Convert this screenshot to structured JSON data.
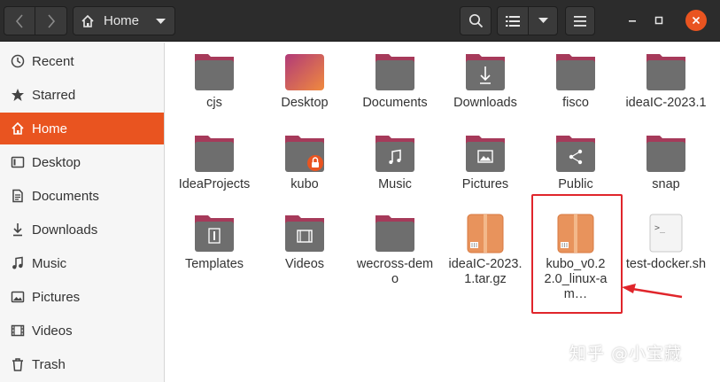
{
  "header": {
    "location": "Home",
    "window_controls": [
      "minimize",
      "maximize",
      "close"
    ]
  },
  "sidebar": {
    "items": [
      {
        "label": "Recent",
        "icon": "clock-icon"
      },
      {
        "label": "Starred",
        "icon": "star-icon"
      },
      {
        "label": "Home",
        "icon": "home-icon",
        "active": true
      },
      {
        "label": "Desktop",
        "icon": "desktop-icon"
      },
      {
        "label": "Documents",
        "icon": "document-icon"
      },
      {
        "label": "Downloads",
        "icon": "download-icon"
      },
      {
        "label": "Music",
        "icon": "music-icon"
      },
      {
        "label": "Pictures",
        "icon": "picture-icon"
      },
      {
        "label": "Videos",
        "icon": "video-icon"
      },
      {
        "label": "Trash",
        "icon": "trash-icon"
      }
    ]
  },
  "files": [
    {
      "name": "cjs",
      "type": "folder"
    },
    {
      "name": "Desktop",
      "type": "desktop-folder"
    },
    {
      "name": "Documents",
      "type": "folder"
    },
    {
      "name": "Downloads",
      "type": "downloads-folder"
    },
    {
      "name": "fisco",
      "type": "folder"
    },
    {
      "name": "ideaIC-2023.1",
      "type": "folder"
    },
    {
      "name": "IdeaProjects",
      "type": "folder"
    },
    {
      "name": "kubo",
      "type": "locked-folder"
    },
    {
      "name": "Music",
      "type": "music-folder"
    },
    {
      "name": "Pictures",
      "type": "pictures-folder"
    },
    {
      "name": "Public",
      "type": "share-folder"
    },
    {
      "name": "snap",
      "type": "folder"
    },
    {
      "name": "Templates",
      "type": "templates-folder"
    },
    {
      "name": "Videos",
      "type": "videos-folder"
    },
    {
      "name": "wecross-demo",
      "type": "folder"
    },
    {
      "name": "ideaIC-2023.1.tar.gz",
      "type": "archive"
    },
    {
      "name": "kubo_v0.22.0_linux-am…",
      "type": "archive",
      "highlighted": true
    },
    {
      "name": "test-docker.sh",
      "type": "script"
    }
  ],
  "colors": {
    "accent": "#e95420",
    "folder_top": "#a63a5a",
    "folder_body": "#6e6e6e",
    "highlight": "#e0252b",
    "archive": "#e8935c"
  },
  "watermark": "知乎 @小宝藏"
}
